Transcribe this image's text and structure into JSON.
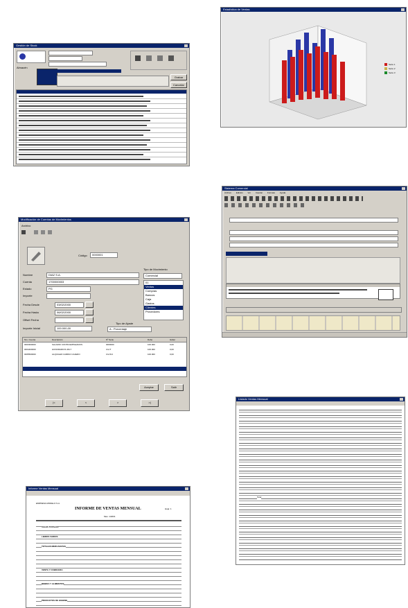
{
  "colors": {
    "titlebar": "#0a246a",
    "window": "#d4d0c8",
    "bar_red": "#cc1b1b",
    "bar_blue": "#2a37a6",
    "legend_green": "#1a8a2a"
  },
  "win_top_left": {
    "title": "Gestión de Stock",
    "section_label": "Almacén",
    "btn_label": "Grabar",
    "btn2_label": "Cancelar"
  },
  "win_chart": {
    "title": "Estadística de Ventas",
    "legend": [
      "Serie 1",
      "Serie 2",
      "Serie 3"
    ]
  },
  "win_form": {
    "title": "Modificación de Cuentas de Movimientos",
    "menu": "Archivo",
    "code_label": "Código",
    "code_value": "0000001",
    "fields": [
      {
        "label": "Nombre",
        "value": "DIAZ S.A."
      },
      {
        "label": "Cuenta",
        "value": "1700000003"
      },
      {
        "label": "Estado",
        "value": "PG"
      },
      {
        "label": "Importe",
        "value": ""
      },
      {
        "label": "Fecha Desde",
        "value": "03/02/2000"
      },
      {
        "label": "Fecha Hasta",
        "value": "06/02/2000"
      },
      {
        "label": "Offset Fecha",
        "value": ""
      },
      {
        "label": "Importe Inicial",
        "value": "100.000,00"
      }
    ],
    "right_label": "Tipo de Movimiento",
    "right_select": "Comercial",
    "list": [
      "01",
      "Ventas",
      "Compras",
      "Bancos",
      "Caja",
      "Gastos",
      "Clientes",
      "Provedores"
    ],
    "list_selected": [
      1,
      6
    ],
    "combo_label": "Tipo de Ajuste",
    "combo_value": "A - Porcentaje",
    "table_headers": [
      "Nro. Cuenta",
      "Descripción",
      "Nº Serie",
      "Debe",
      "Haber"
    ],
    "table_rows": [
      [
        "0003300000",
        "SALARIO CONTR.EMPLEADOS",
        "0000000",
        "100.000",
        "0,00"
      ],
      [
        "0004400000",
        "HONORARIOS 4M-7",
        "C/L/T",
        "100.000",
        "0,00"
      ],
      [
        "0005500000",
        "ALQUILER CAMINO CAJERO",
        "C/L/S/1",
        "100.000",
        "0,00"
      ]
    ],
    "btn_accept": "Aceptar",
    "btn_exit": "Salir",
    "nav_buttons": [
      "|<",
      "<",
      ">",
      ">|"
    ]
  },
  "win_erp": {
    "title": "Sistema Comercial",
    "menu": [
      "Archivo",
      "Edición",
      "Ver",
      "Insertar",
      "Formato",
      "Ayuda"
    ]
  },
  "win_report_right": {
    "title": "Listado Ventas Mensual",
    "subtotal": "Total"
  },
  "win_report_bottom": {
    "title": "Informe Ventas Mensual",
    "company": "EMPRESA MODELO S.A.",
    "heading": "INFORME DE VENTAS MENSUAL",
    "page": "Hoja: 1",
    "subheading": "Mes: 1/2001",
    "groups": [
      "VALES TOTALES",
      "LIBROS VARIOS",
      "TOTALES MERCANCÍAS",
      "VENTA Y COBRANZA",
      "BEBIDA Y ALIMENTOS",
      "PRODUCTOS DE HIGIENE"
    ]
  }
}
